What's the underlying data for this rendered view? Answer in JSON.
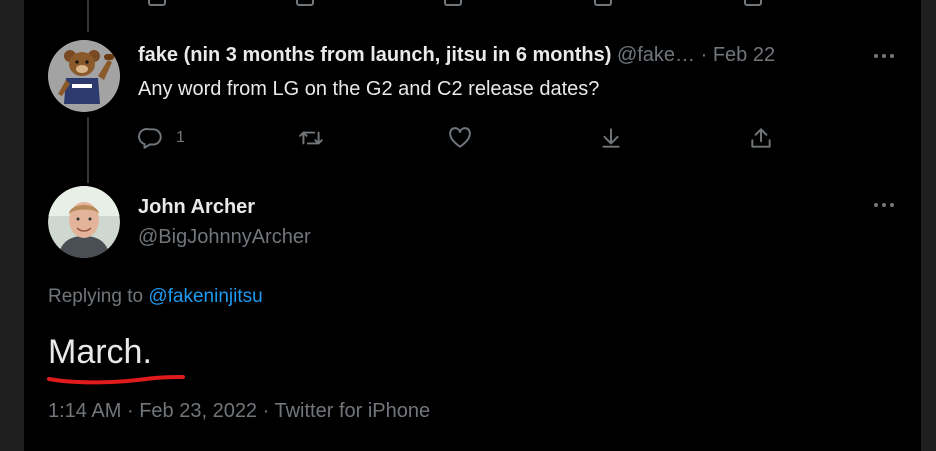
{
  "reply_tweet": {
    "display_name": "fake (nin 3 months from launch, jitsu in 6 months)",
    "handle": "@fake…",
    "separator": "·",
    "date": "Feb 22",
    "text": "Any word from LG on the G2 and C2 release dates?",
    "reply_count": "1"
  },
  "main_tweet": {
    "display_name": "John Archer",
    "handle": "@BigJohnnyArcher",
    "replying_prefix": "Replying to",
    "replying_handle": "@fakeninjitsu",
    "text": "March.",
    "time": "1:14 AM",
    "sep": "·",
    "date": "Feb 23, 2022",
    "source": "Twitter for iPhone"
  },
  "colors": {
    "background": "#000000",
    "outer": "#1f1f1f",
    "text": "#e7e9ea",
    "muted": "#71767b",
    "link": "#1d9bf0",
    "annotation": "#e01b1b"
  },
  "icons": [
    "reply-icon",
    "retweet-icon",
    "like-icon",
    "download-icon",
    "share-icon",
    "more-icon"
  ]
}
